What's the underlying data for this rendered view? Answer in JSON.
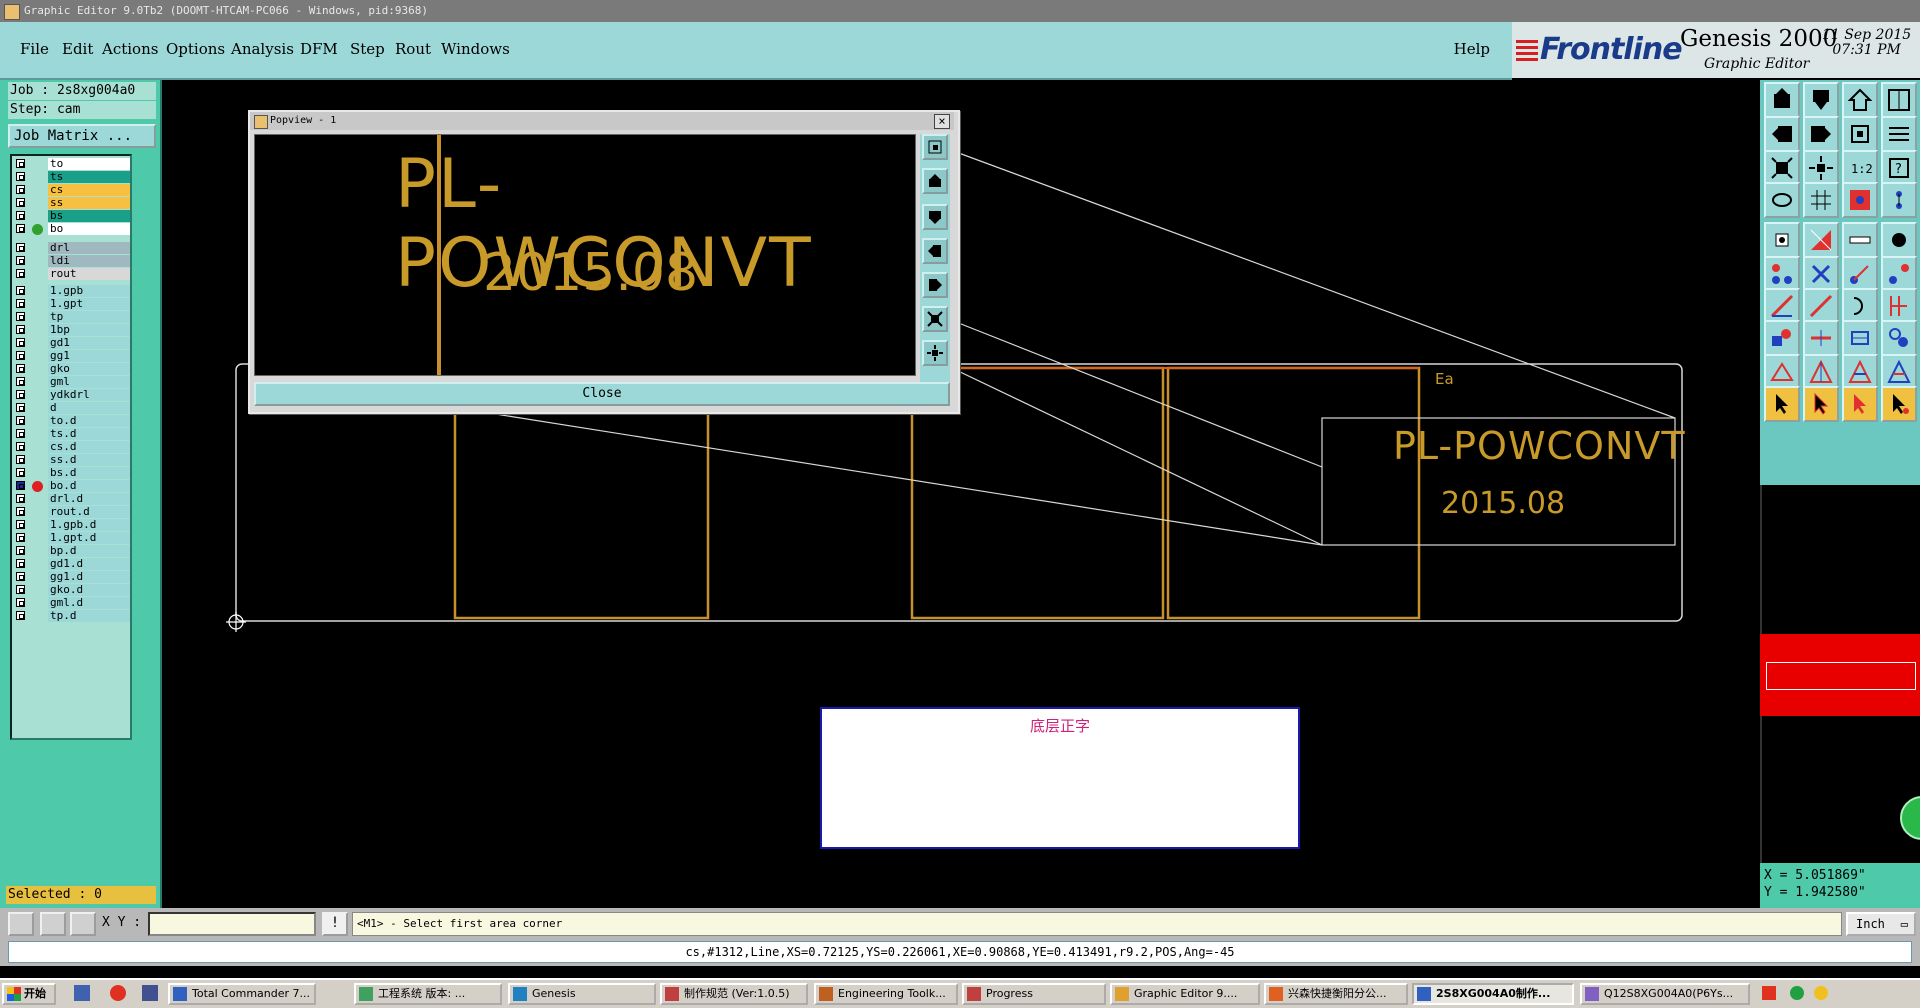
{
  "window": {
    "title": "Graphic Editor 9.0Tb2 (DOOMT-HTCAM-PC066 - Windows, pid:9368)"
  },
  "menu": {
    "items": [
      {
        "label": "File"
      },
      {
        "label": "Edit"
      },
      {
        "label": "Actions"
      },
      {
        "label": "Options"
      },
      {
        "label": "Analysis"
      },
      {
        "label": "DFM"
      },
      {
        "label": "Step"
      },
      {
        "label": "Rout"
      },
      {
        "label": "Windows"
      }
    ],
    "help": "Help"
  },
  "brand": {
    "logo": "Frontline",
    "product": "Genesis 2000",
    "subtitle": "Graphic Editor",
    "date": "11 Sep 2015",
    "time": "07:31 PM"
  },
  "left_panel": {
    "job": "Job : 2s8xg004a0",
    "step": "Step: cam",
    "job_matrix": "Job Matrix ...",
    "selected": "Selected : 0"
  },
  "layers": [
    {
      "name": "to",
      "bg": "#ffffff",
      "dot": ""
    },
    {
      "name": "ts",
      "bg": "#1aa088",
      "dot": ""
    },
    {
      "name": "cs",
      "bg": "#f8c040",
      "dot": ""
    },
    {
      "name": "ss",
      "bg": "#f8c040",
      "dot": ""
    },
    {
      "name": "bs",
      "bg": "#1aa088",
      "dot": ""
    },
    {
      "name": "bo",
      "bg": "#ffffff",
      "dot": "#30a030"
    },
    {
      "name": "drl",
      "bg": "#a0b8c0",
      "dot": ""
    },
    {
      "name": "ldi",
      "bg": "#a0b8c0",
      "dot": ""
    },
    {
      "name": "rout",
      "bg": "#d8d8d8",
      "dot": ""
    },
    {
      "name": "1.gpb",
      "bg": "#9cd8d8",
      "dot": ""
    },
    {
      "name": "1.gpt",
      "bg": "#9cd8d8",
      "dot": ""
    },
    {
      "name": "tp",
      "bg": "#9cd8d8",
      "dot": ""
    },
    {
      "name": "1bp",
      "bg": "#9cd8d8",
      "dot": ""
    },
    {
      "name": "gd1",
      "bg": "#9cd8d8",
      "dot": ""
    },
    {
      "name": "gg1",
      "bg": "#9cd8d8",
      "dot": ""
    },
    {
      "name": "gko",
      "bg": "#9cd8d8",
      "dot": ""
    },
    {
      "name": "gml",
      "bg": "#9cd8d8",
      "dot": ""
    },
    {
      "name": "ydkdrl",
      "bg": "#9cd8d8",
      "dot": ""
    },
    {
      "name": "d",
      "bg": "#9cd8d8",
      "dot": ""
    },
    {
      "name": "to.d",
      "bg": "#9cd8d8",
      "dot": ""
    },
    {
      "name": "ts.d",
      "bg": "#9cd8d8",
      "dot": ""
    },
    {
      "name": "cs.d",
      "bg": "#9cd8d8",
      "dot": ""
    },
    {
      "name": "ss.d",
      "bg": "#9cd8d8",
      "dot": ""
    },
    {
      "name": "bs.d",
      "bg": "#9cd8d8",
      "dot": ""
    },
    {
      "name": "bo.d",
      "bg": "#9cd8d8",
      "dot": "#e02020"
    },
    {
      "name": "drl.d",
      "bg": "#9cd8d8",
      "dot": ""
    },
    {
      "name": "rout.d",
      "bg": "#9cd8d8",
      "dot": ""
    },
    {
      "name": "1.gpb.d",
      "bg": "#9cd8d8",
      "dot": ""
    },
    {
      "name": "1.gpt.d",
      "bg": "#9cd8d8",
      "dot": ""
    },
    {
      "name": "bp.d",
      "bg": "#9cd8d8",
      "dot": ""
    },
    {
      "name": "gd1.d",
      "bg": "#9cd8d8",
      "dot": ""
    },
    {
      "name": "gg1.d",
      "bg": "#9cd8d8",
      "dot": ""
    },
    {
      "name": "gko.d",
      "bg": "#9cd8d8",
      "dot": ""
    },
    {
      "name": "gml.d",
      "bg": "#9cd8d8",
      "dot": ""
    },
    {
      "name": "tp.d",
      "bg": "#9cd8d8",
      "dot": ""
    }
  ],
  "canvas": {
    "part_name": "PL-POWCONVT",
    "date_code": "2015.08",
    "marker": "Ea",
    "note_text": "底层正字"
  },
  "popview": {
    "title": "Popview - 1",
    "close_button": "Close"
  },
  "coordinates": {
    "x": "X = 5.051869\"",
    "y": "Y = 1.942580\""
  },
  "command_row": {
    "xy_label": "X Y :",
    "xy_value": "",
    "prompt": "<M1> - Select first area corner",
    "units": "Inch"
  },
  "info_line": "cs,#1312,Line,XS=0.72125,YS=0.226061,XE=0.90868,YE=0.413491,r9.2,POS,Ang=-45",
  "taskbar": {
    "start": "开始",
    "tasks": [
      {
        "label": "Total Commander 7...",
        "active": false
      },
      {
        "label": "工程系统  版本: ...",
        "active": false
      },
      {
        "label": "Genesis",
        "active": false
      },
      {
        "label": "制作规范 (Ver:1.0.5)",
        "active": false
      },
      {
        "label": "Engineering Toolk...",
        "active": false
      },
      {
        "label": "Progress",
        "active": false
      },
      {
        "label": "Graphic Editor 9....",
        "active": false
      },
      {
        "label": "兴森快捷衡阳分公...",
        "active": false
      },
      {
        "label": "2S8XG004A0制作...",
        "active": true
      },
      {
        "label": "Q12S8XG004A0(P6Ys...",
        "active": false
      }
    ]
  }
}
